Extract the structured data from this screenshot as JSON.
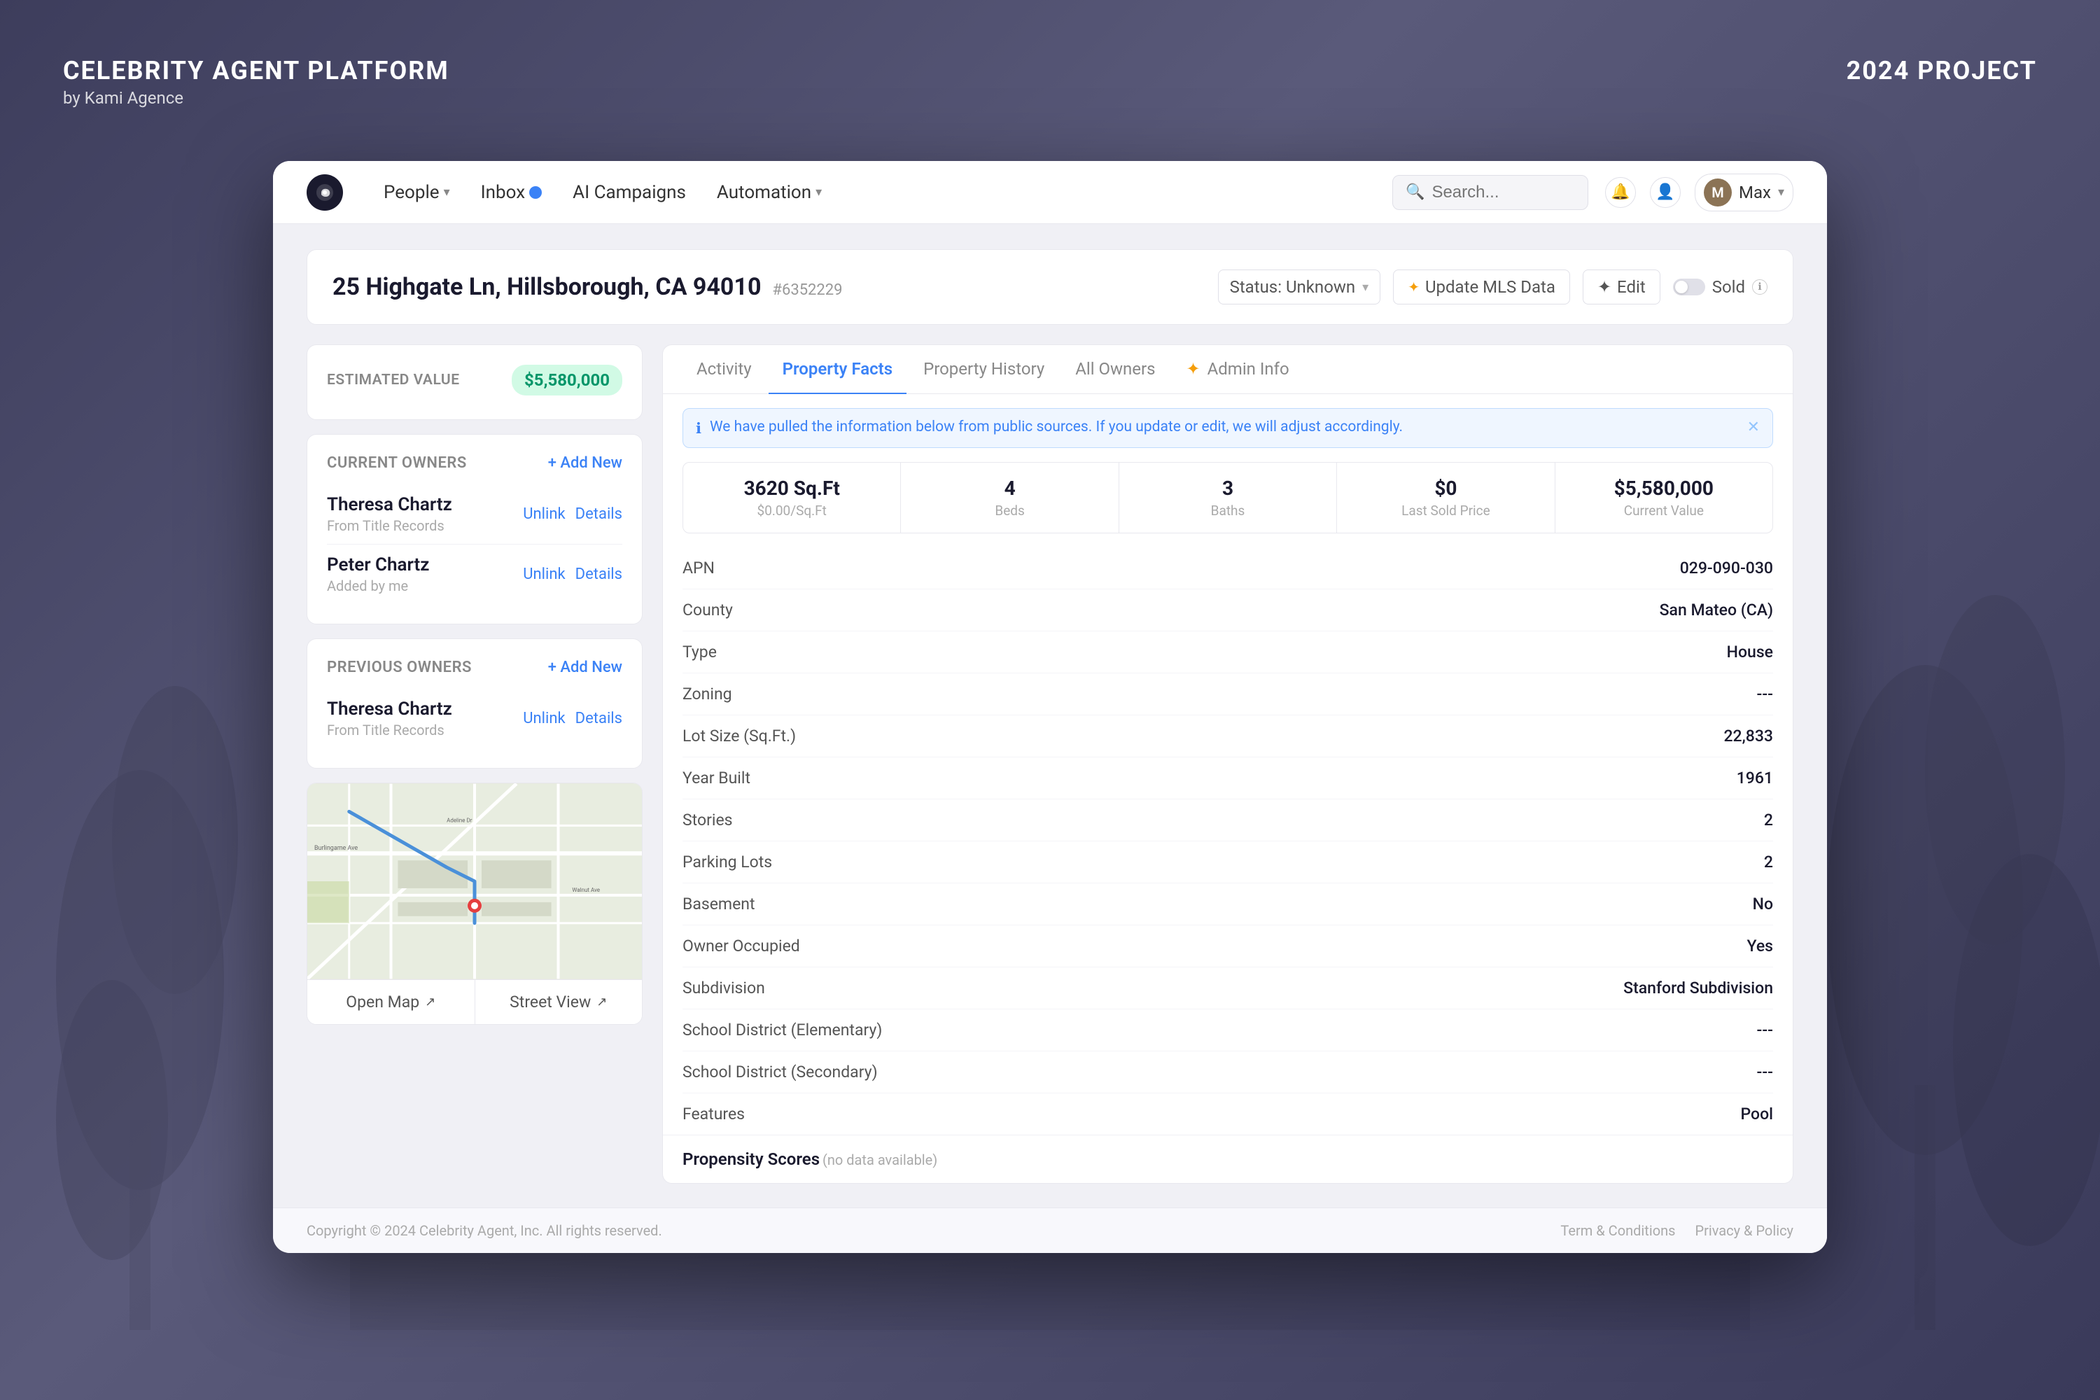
{
  "brand": {
    "title": "CELEBRITY AGENT PLATFORM",
    "subtitle": "by Kami Agence",
    "year": "2024 PROJECT"
  },
  "navbar": {
    "logo_alt": "Celebrity Agent Logo",
    "nav_items": [
      {
        "label": "People",
        "has_chevron": true,
        "has_badge": false
      },
      {
        "label": "Inbox",
        "has_chevron": false,
        "has_badge": true
      },
      {
        "label": "AI Campaigns",
        "has_chevron": false,
        "has_badge": false
      },
      {
        "label": "Automation",
        "has_chevron": true,
        "has_badge": false
      }
    ],
    "search_placeholder": "Search...",
    "user_name": "Max"
  },
  "property": {
    "address": "25 Highgate Ln, Hillsborough, CA 94010",
    "id": "#6352229",
    "status": "Status: Unknown",
    "update_mls_label": "Update MLS Data",
    "edit_label": "Edit",
    "sold_label": "Sold"
  },
  "tabs": [
    {
      "label": "Activity",
      "active": false
    },
    {
      "label": "Property Facts",
      "active": true
    },
    {
      "label": "Property History",
      "active": false
    },
    {
      "label": "All Owners",
      "active": false
    },
    {
      "label": "Admin Info",
      "active": false,
      "has_spark": true
    }
  ],
  "info_banner": {
    "text": "We have pulled the information below from public sources. If you update or edit, we will adjust accordingly."
  },
  "stats": [
    {
      "main": "3620 Sq.Ft",
      "sub": "$0.00/Sq.Ft"
    },
    {
      "main": "4",
      "sub": "Beds"
    },
    {
      "main": "3",
      "sub": "Baths"
    },
    {
      "main": "$0",
      "sub": "Last Sold Price"
    },
    {
      "main": "$5,580,000",
      "sub": "Current Value"
    }
  ],
  "facts": [
    {
      "label": "APN",
      "value": "029-090-030"
    },
    {
      "label": "County",
      "value": "San Mateo (CA)"
    },
    {
      "label": "Type",
      "value": "House"
    },
    {
      "label": "Zoning",
      "value": "---"
    },
    {
      "label": "Lot Size (Sq.Ft.)",
      "value": "22,833"
    },
    {
      "label": "Year Built",
      "value": "1961"
    },
    {
      "label": "Stories",
      "value": "2"
    },
    {
      "label": "Parking Lots",
      "value": "2"
    },
    {
      "label": "Basement",
      "value": "No"
    },
    {
      "label": "Owner Occupied",
      "value": "Yes"
    },
    {
      "label": "Subdivision",
      "value": "Stanford Subdivision"
    },
    {
      "label": "School District (Elementary)",
      "value": "---"
    },
    {
      "label": "School District (Secondary)",
      "value": "---"
    },
    {
      "label": "Features",
      "value": "Pool"
    }
  ],
  "propensity": {
    "title": "Propensity Scores",
    "sub": "(no data available)"
  },
  "current_owners": {
    "title": "CURRENT OWNERS",
    "add_label": "+ Add New",
    "owners": [
      {
        "name": "Theresa Chartz",
        "sub": "From Title Records"
      },
      {
        "name": "Peter Chartz",
        "sub": "Added by me"
      }
    ]
  },
  "previous_owners": {
    "title": "PREVIOUS OWNERS",
    "add_label": "+ Add New",
    "owners": [
      {
        "name": "Theresa Chartz",
        "sub": "From Title Records"
      }
    ]
  },
  "map": {
    "open_map_label": "Open Map",
    "street_view_label": "Street View"
  },
  "estimated_value": {
    "label": "ESTIMATED VALUE",
    "value": "$5,580,000"
  },
  "footer": {
    "copyright": "Copyright © 2024 Celebrity Agent, Inc. All rights reserved.",
    "links": [
      "Term & Conditions",
      "Privacy & Policy"
    ]
  }
}
